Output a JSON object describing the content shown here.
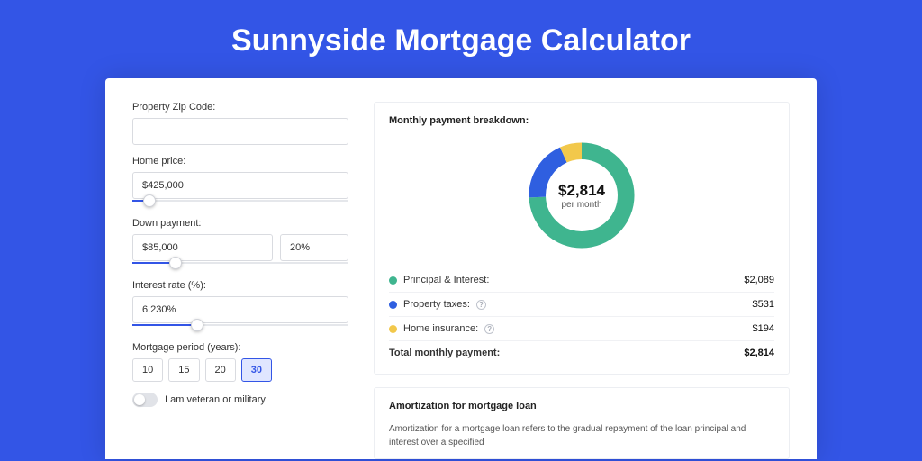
{
  "page": {
    "title": "Sunnyside Mortgage Calculator"
  },
  "form": {
    "zip_label": "Property Zip Code:",
    "zip_value": "",
    "price_label": "Home price:",
    "price_value": "$425,000",
    "price_slider_pct": 8,
    "down_label": "Down payment:",
    "down_value": "$85,000",
    "down_pct": "20%",
    "down_slider_pct": 20,
    "rate_label": "Interest rate (%):",
    "rate_value": "6.230%",
    "rate_slider_pct": 30,
    "period_label": "Mortgage period (years):",
    "periods": [
      "10",
      "15",
      "20",
      "30"
    ],
    "period_active": 3,
    "veteran_label": "I am veteran or military"
  },
  "breakdown": {
    "title": "Monthly payment breakdown:",
    "total": "$2,814",
    "per": "per month",
    "items": [
      {
        "label": "Principal & Interest:",
        "value": "$2,089",
        "color": "#3fb58f",
        "pct": 74.2,
        "info": false
      },
      {
        "label": "Property taxes:",
        "value": "$531",
        "color": "#2f5fe0",
        "pct": 18.9,
        "info": true
      },
      {
        "label": "Home insurance:",
        "value": "$194",
        "color": "#f2c84b",
        "pct": 6.9,
        "info": true
      }
    ],
    "total_label": "Total monthly payment:",
    "total_value": "$2,814"
  },
  "amort": {
    "title": "Amortization for mortgage loan",
    "text": "Amortization for a mortgage loan refers to the gradual repayment of the loan principal and interest over a specified"
  },
  "chart_data": {
    "type": "pie",
    "title": "Monthly payment breakdown",
    "series": [
      {
        "name": "Principal & Interest",
        "value": 2089,
        "pct": 74.2,
        "color": "#3fb58f"
      },
      {
        "name": "Property taxes",
        "value": 531,
        "pct": 18.9,
        "color": "#2f5fe0"
      },
      {
        "name": "Home insurance",
        "value": 194,
        "pct": 6.9,
        "color": "#f2c84b"
      }
    ],
    "total": 2814,
    "center_label": "$2,814",
    "center_sub": "per month"
  }
}
